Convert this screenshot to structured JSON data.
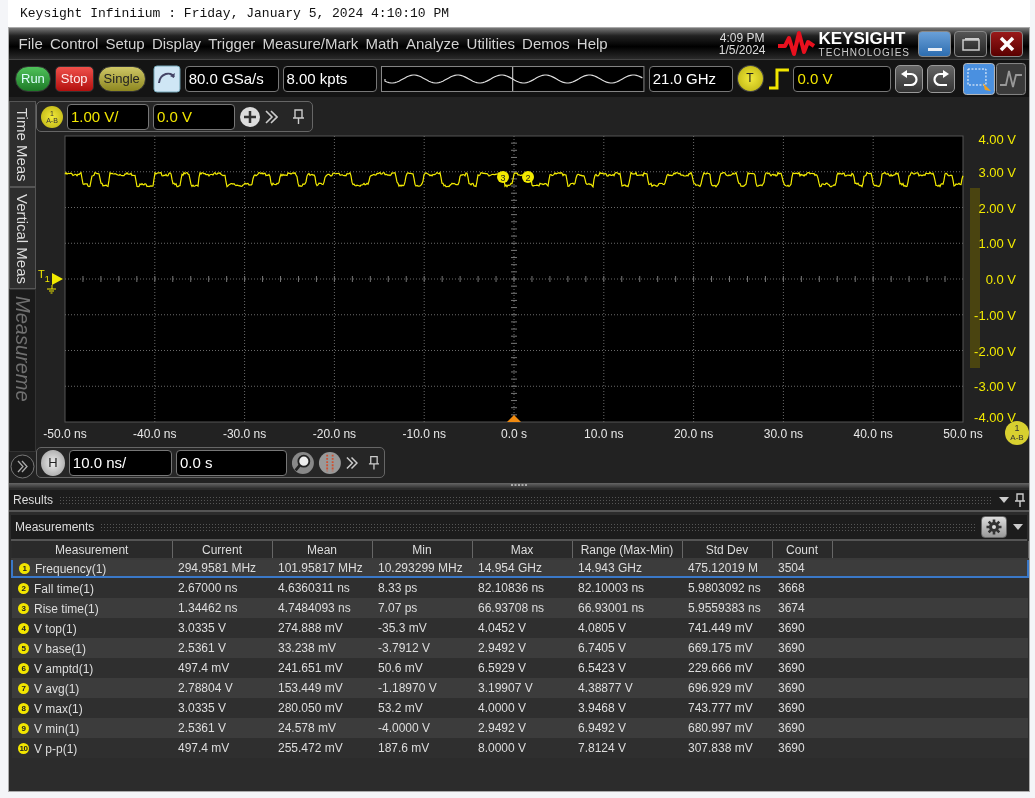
{
  "window": {
    "title": "Keysight Infiniium : Friday, January 5, 2024 4:10:10 PM"
  },
  "menu": [
    "File",
    "Control",
    "Setup",
    "Display",
    "Trigger",
    "Measure/Mark",
    "Math",
    "Analyze",
    "Utilities",
    "Demos",
    "Help"
  ],
  "clock": {
    "time": "4:09 PM",
    "date": "1/5/2024"
  },
  "logo": {
    "name": "KEYSIGHT",
    "subtitle": "TECHNOLOGIES"
  },
  "toolbar": {
    "acquisition_buttons": [
      {
        "label": "Run",
        "kind": "run"
      },
      {
        "label": "Stop",
        "kind": "stop"
      },
      {
        "label": "Single",
        "kind": "single"
      }
    ],
    "sample_rate": "80.0 GSa/s",
    "memory_depth": "8.00 kpts",
    "bandwidth": "21.0 GHz",
    "trigger_badge": "T",
    "trigger_level": "0.0 V"
  },
  "side_tabs": [
    {
      "label": "Time Meas",
      "disabled": false
    },
    {
      "label": "Vertical Meas",
      "disabled": false
    },
    {
      "label": "Measureme",
      "disabled": true
    }
  ],
  "channel_bar": {
    "badge": "1",
    "badge_sub": "A-B",
    "scale": "1.00 V/",
    "offset": "0.0 V"
  },
  "plot": {
    "y_labels": [
      "4.00 V",
      "3.00 V",
      "2.00 V",
      "1.00 V",
      "0.0 V",
      "-1.00 V",
      "-2.00 V",
      "-3.00 V",
      "-4.00 V"
    ],
    "x_labels": [
      "-50.0 ns",
      "-40.0 ns",
      "-30.0 ns",
      "-20.0 ns",
      "-10.0 ns",
      "0.0 s",
      "10.0 ns",
      "20.0 ns",
      "30.0 ns",
      "40.0 ns",
      "50.0 ns"
    ],
    "markers": [
      "3",
      "2"
    ],
    "ground_marker": "T",
    "ground_sub": "1",
    "corner_badge": "1",
    "corner_sub": "A-B"
  },
  "horizontal_bar": {
    "badge": "H",
    "scale": "10.0 ns/",
    "position": "0.0 s"
  },
  "results": {
    "title": "Results",
    "panel_title": "Measurements",
    "columns": [
      "Measurement",
      "Current",
      "Mean",
      "Min",
      "Max",
      "Range (Max-Min)",
      "Std Dev",
      "Count"
    ],
    "rows": [
      {
        "marker": "1",
        "selected": true,
        "cells": [
          "Frequency(1)",
          "294.9581 MHz",
          "101.95817 MHz",
          "10.293299 MHz",
          "14.954 GHz",
          "14.943 GHz",
          "475.12019 M",
          "3504"
        ]
      },
      {
        "marker": "2",
        "selected": false,
        "cells": [
          "Fall time(1)",
          "2.67000 ns",
          "4.6360311 ns",
          "8.33 ps",
          "82.10836 ns",
          "82.10003 ns",
          "5.9803092 ns",
          "3668"
        ]
      },
      {
        "marker": "3",
        "selected": false,
        "cells": [
          "Rise time(1)",
          "1.34462 ns",
          "4.7484093 ns",
          "7.07 ps",
          "66.93708 ns",
          "66.93001 ns",
          "5.9559383 ns",
          "3674"
        ]
      },
      {
        "marker": "4",
        "selected": false,
        "cells": [
          "V top(1)",
          "3.0335 V",
          "274.888 mV",
          "-35.3 mV",
          "4.0452 V",
          "4.0805 V",
          "741.449 mV",
          "3690"
        ]
      },
      {
        "marker": "5",
        "selected": false,
        "cells": [
          "V base(1)",
          "2.5361 V",
          "33.238 mV",
          "-3.7912 V",
          "2.9492 V",
          "6.7405 V",
          "669.175 mV",
          "3690"
        ]
      },
      {
        "marker": "6",
        "selected": false,
        "cells": [
          "V amptd(1)",
          "497.4 mV",
          "241.651 mV",
          "50.6 mV",
          "6.5929 V",
          "6.5423 V",
          "229.666 mV",
          "3690"
        ]
      },
      {
        "marker": "7",
        "selected": false,
        "cells": [
          "V avg(1)",
          "2.78804 V",
          "153.449 mV",
          "-1.18970 V",
          "3.19907 V",
          "4.38877 V",
          "696.929 mV",
          "3690"
        ]
      },
      {
        "marker": "8",
        "selected": false,
        "cells": [
          "V max(1)",
          "3.0335 V",
          "280.050 mV",
          "53.2 mV",
          "4.0000 V",
          "3.9468 V",
          "743.777 mV",
          "3690"
        ]
      },
      {
        "marker": "9",
        "selected": false,
        "cells": [
          "V min(1)",
          "2.5361 V",
          "24.578 mV",
          "-4.0000 V",
          "2.9492 V",
          "6.9492 V",
          "680.997 mV",
          "3690"
        ]
      },
      {
        "marker": "10",
        "selected": false,
        "cells": [
          "V p-p(1)",
          "497.4 mV",
          "255.472 mV",
          "187.6 mV",
          "8.0000 V",
          "7.8124 V",
          "307.838 mV",
          "3690"
        ]
      }
    ]
  }
}
